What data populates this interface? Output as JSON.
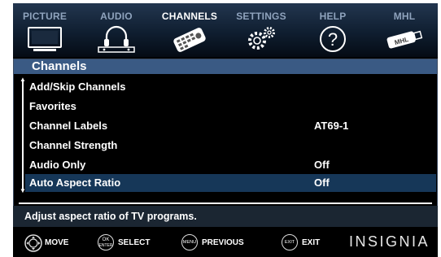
{
  "tabs": [
    {
      "label": "PICTURE",
      "icon": "tv-icon",
      "active": false
    },
    {
      "label": "AUDIO",
      "icon": "headphones-icon",
      "active": false
    },
    {
      "label": "CHANNELS",
      "icon": "remote-control-icon",
      "active": true
    },
    {
      "label": "SETTINGS",
      "icon": "gears-icon",
      "active": false
    },
    {
      "label": "HELP",
      "icon": "question-icon",
      "active": false
    },
    {
      "label": "MHL",
      "icon": "mhl-cable-icon",
      "active": false
    }
  ],
  "mhl_icon_text": "MHL",
  "panel": {
    "title": "Channels",
    "items": [
      {
        "label": "Add/Skip Channels",
        "value": ""
      },
      {
        "label": "Favorites",
        "value": ""
      },
      {
        "label": "Channel Labels",
        "value": "AT69-1"
      },
      {
        "label": "Channel Strength",
        "value": ""
      },
      {
        "label": "Audio Only",
        "value": "Off"
      },
      {
        "label": "Auto Aspect Ratio",
        "value": "Off",
        "selected": true
      }
    ]
  },
  "help_text": "Adjust aspect ratio of TV programs.",
  "footer": {
    "move": {
      "label": "MOVE"
    },
    "select": {
      "label": "SELECT",
      "icon_text_top": "OK",
      "icon_text_bottom": "ENTER"
    },
    "previous": {
      "label": "PREVIOUS",
      "icon_text": "MENU"
    },
    "exit": {
      "label": "EXIT",
      "icon_text": "EXIT"
    },
    "brand": "INSIGNIA"
  },
  "colors": {
    "accent_title_bar": "#3a5a84",
    "selected_row": "#163758",
    "inactive_tab_text": "#8fa3bd"
  }
}
